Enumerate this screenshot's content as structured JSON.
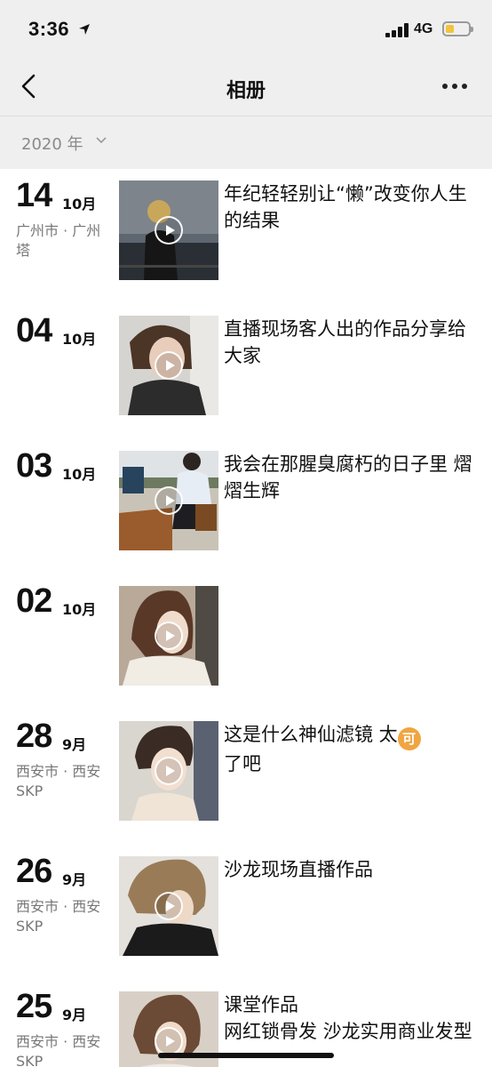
{
  "status_bar": {
    "time": "3:36",
    "network": "4G"
  },
  "navbar": {
    "title": "相册"
  },
  "year_selector": {
    "label": "2020 年"
  },
  "posts": [
    {
      "day": "14",
      "month": "10月",
      "location": "广州市 · 广州塔",
      "caption": "年纪轻轻别让“懒”改变你人生的结果"
    },
    {
      "day": "04",
      "month": "10月",
      "location": "",
      "caption": "直播现场客人出的作品分享给大家"
    },
    {
      "day": "03",
      "month": "10月",
      "location": "",
      "caption": "我会在那腥臭腐朽的日子里 熠熠生辉"
    },
    {
      "day": "02",
      "month": "10月",
      "location": "",
      "caption": ""
    },
    {
      "day": "28",
      "month": "9月",
      "location": "西安市 · 西安SKP",
      "caption": "这是什么神仙滤镜  太",
      "caption_emoji": "可",
      "caption_tail": "了吧"
    },
    {
      "day": "26",
      "month": "9月",
      "location": "西安市 · 西安SKP",
      "caption": "沙龙现场直播作品"
    },
    {
      "day": "25",
      "month": "9月",
      "location": "西安市 · 西安SKP",
      "caption": "课堂作品\n网红锁骨发 沙龙实用商业发型"
    }
  ],
  "colors": {
    "top_background": "#efefef",
    "year_text": "#8a8a8a",
    "location_text": "#777777",
    "emoji_badge": "#f0a541",
    "battery": "#f3c33d"
  }
}
